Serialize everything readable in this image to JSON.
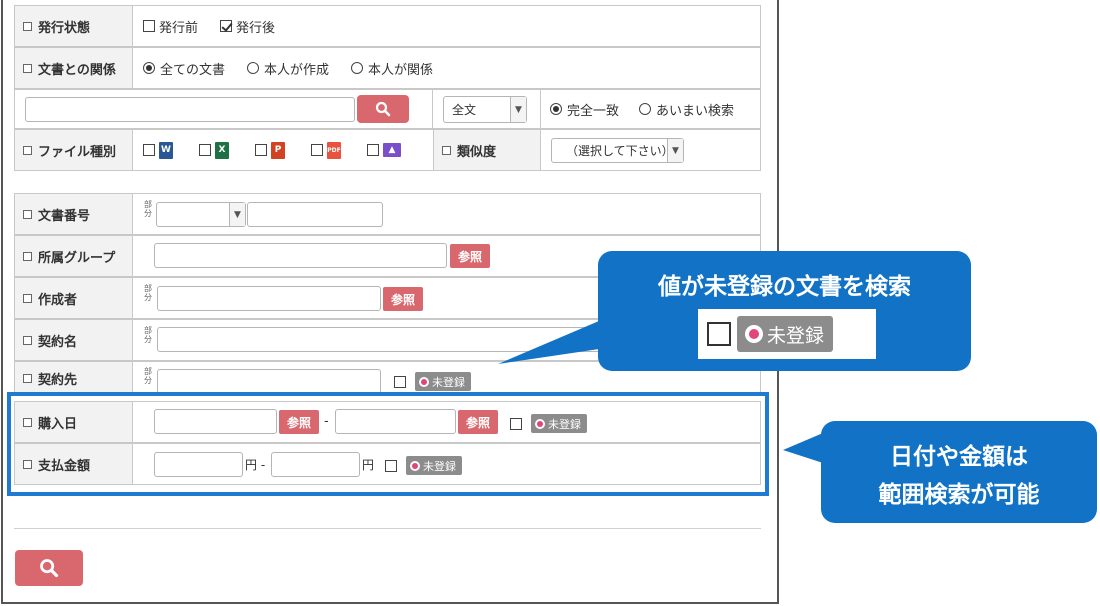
{
  "rows": {
    "status": {
      "label": "発行状態",
      "options": [
        "発行前",
        "発行後"
      ],
      "checked": [
        false,
        true
      ]
    },
    "relation": {
      "label": "文書との関係",
      "options": [
        "全ての文書",
        "本人が作成",
        "本人が関係"
      ],
      "selected": 0
    },
    "keyword": {
      "scope": "全文",
      "match_options": [
        "完全一致",
        "あいまい検索"
      ],
      "match_selected": 0
    },
    "filetype": {
      "label": "ファイル種別",
      "icons": [
        "word-icon",
        "excel-icon",
        "powerpoint-icon",
        "pdf-icon",
        "image-icon"
      ]
    },
    "similarity": {
      "label": "類似度",
      "placeholder": "（選択して下さい）"
    },
    "docnum": {
      "label": "文書番号",
      "bubun": "部分"
    },
    "group": {
      "label": "所属グループ",
      "ref": "参照"
    },
    "author": {
      "label": "作成者",
      "bubun": "部分",
      "ref": "参照"
    },
    "contract_name": {
      "label": "契約名",
      "bubun": "部分"
    },
    "counterparty": {
      "label": "契約先",
      "bubun": "部分",
      "unreg": "未登録"
    },
    "purchase_date": {
      "label": "購入日",
      "ref": "参照",
      "sep": "-",
      "unreg": "未登録"
    },
    "amount": {
      "label": "支払金額",
      "unit": "円",
      "sep": "-",
      "unreg": "未登録"
    }
  },
  "callouts": {
    "unregistered": {
      "title": "値が未登録の文書を検索",
      "badge": "未登録"
    },
    "range": {
      "line1": "日付や金額は",
      "line2": "範囲検索が可能"
    }
  },
  "colors": {
    "accent_red": "#d9686e",
    "callout_blue": "#1273c6",
    "badge_gray": "#8c8c8c"
  }
}
